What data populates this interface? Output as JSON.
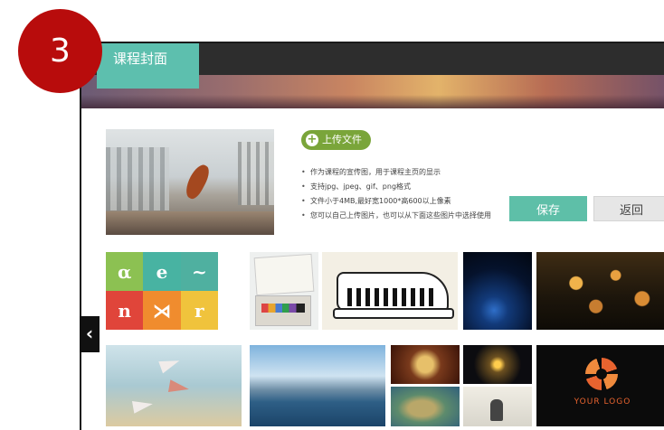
{
  "step_badge": "3",
  "header": {
    "title": "课程封面"
  },
  "upload": {
    "label": "上传文件",
    "icon": "plus-circle-icon"
  },
  "notes": [
    "作为课程的宣传图，用于课程主页的显示",
    "支持jpg、jpeg、gif、png格式",
    "文件小于4MB,最好宽1000*高600以上像素",
    "您可以自己上传图片，也可以从下面这些图片中选择使用"
  ],
  "actions": {
    "save_label": "保存",
    "back_label": "返回"
  },
  "side_nav": {
    "icon": "chevron-left-icon",
    "glyph": "‹"
  },
  "thumb_logo_text": "YOUR LOGO",
  "colors": {
    "accent": "#5dbfae",
    "upload_green": "#7aa53a",
    "badge_red": "#b80c0c"
  }
}
